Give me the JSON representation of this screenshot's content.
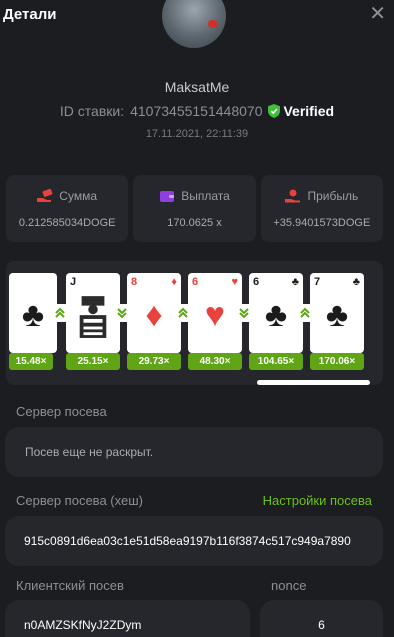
{
  "header": {
    "title": "Детали",
    "close_icon": "close-icon"
  },
  "user": {
    "name": "MaksatMe"
  },
  "bet": {
    "id_label": "ID ставки:",
    "id_value": "4107345515144807​0",
    "verified_label": "Verified",
    "datetime": "17.11.2021, 22:11:39"
  },
  "stats": [
    {
      "icon": "money-hand-icon",
      "label": "Сумма",
      "value": "0.212585034DOGE",
      "color": "#e8423c"
    },
    {
      "icon": "wallet-icon",
      "label": "Выплата",
      "value": "170.0625 x",
      "color": "#8f3ee0"
    },
    {
      "icon": "profit-icon",
      "label": "Прибыль",
      "value": "+35.9401573DOGE",
      "color": "#e8423c"
    }
  ],
  "cards": [
    {
      "rank": "",
      "suit": "♣",
      "color": "black",
      "multiplier": "15.48×"
    },
    {
      "rank": "J",
      "suit": "♣",
      "color": "black",
      "multiplier": "25.15×",
      "face": true
    },
    {
      "rank": "8",
      "suit": "♦",
      "color": "red",
      "multiplier": "29.73×"
    },
    {
      "rank": "6",
      "suit": "♥",
      "color": "red",
      "multiplier": "48.30×"
    },
    {
      "rank": "6",
      "suit": "♣",
      "color": "black",
      "multiplier": "104.65×"
    },
    {
      "rank": "7",
      "suit": "♣",
      "color": "black",
      "multiplier": "170.06×"
    }
  ],
  "arrows": [
    "higher",
    "lower",
    "higher",
    "lower",
    "higher"
  ],
  "server_seed": {
    "label": "Сервер посева",
    "value": "Посев еще не раскрыт."
  },
  "server_seed_hash": {
    "label": "Сервер посева (хеш)",
    "settings_link": "Настройки посева",
    "value": "915c0891d6ea03c1e51d58ea9197b116f3874c517c949a7890"
  },
  "client_seed": {
    "label": "Клиентский посев",
    "value": "n0AMZSKfNyJ2ZDym"
  },
  "nonce": {
    "label": "nonce",
    "value": "6"
  },
  "colors": {
    "background": "#1c1d21",
    "panel": "#25272c",
    "accent_green": "#6cbf1f",
    "multiplier_green": "#5fa515"
  }
}
